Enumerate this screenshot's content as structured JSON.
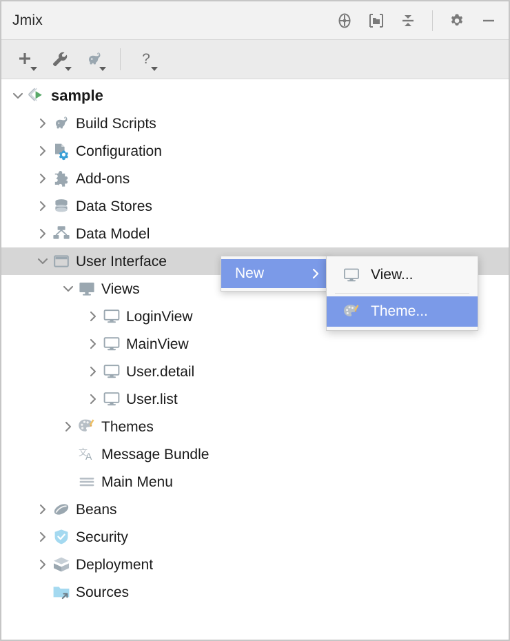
{
  "window": {
    "title": "Jmix"
  },
  "titlebar": {
    "actions": [
      {
        "name": "locate-icon",
        "label": "Locate"
      },
      {
        "name": "expand-folder-icon",
        "label": "Open Directory"
      },
      {
        "name": "collapse-all-icon",
        "label": "Collapse All"
      },
      {
        "name": "settings-gear-icon",
        "label": "Settings"
      },
      {
        "name": "minimize-icon",
        "label": "Hide"
      }
    ]
  },
  "toolbar": {
    "buttons": [
      {
        "name": "add-icon",
        "label": "New"
      },
      {
        "name": "wrench-icon",
        "label": "Tools"
      },
      {
        "name": "gradle-elephant-icon",
        "label": "Gradle"
      },
      {
        "name": "help-question-icon",
        "label": "Help"
      }
    ]
  },
  "tree": {
    "nodes": [
      {
        "label": "sample",
        "icon": "jmix-project-icon",
        "depth": 0,
        "arrow": "down",
        "root": true,
        "selected": false
      },
      {
        "label": "Build Scripts",
        "icon": "gradle-elephant-icon",
        "depth": 1,
        "arrow": "right",
        "root": false,
        "selected": false
      },
      {
        "label": "Configuration",
        "icon": "configuration-icon",
        "depth": 1,
        "arrow": "right",
        "root": false,
        "selected": false
      },
      {
        "label": "Add-ons",
        "icon": "puzzle-piece-icon",
        "depth": 1,
        "arrow": "right",
        "root": false,
        "selected": false
      },
      {
        "label": "Data Stores",
        "icon": "database-icon",
        "depth": 1,
        "arrow": "right",
        "root": false,
        "selected": false
      },
      {
        "label": "Data Model",
        "icon": "data-model-icon",
        "depth": 1,
        "arrow": "right",
        "root": false,
        "selected": false
      },
      {
        "label": "User Interface",
        "icon": "user-interface-icon",
        "depth": 1,
        "arrow": "down",
        "root": false,
        "selected": true
      },
      {
        "label": "Views",
        "icon": "views-folder-icon",
        "depth": 2,
        "arrow": "down",
        "root": false,
        "selected": false
      },
      {
        "label": "LoginView",
        "icon": "view-monitor-icon",
        "depth": 3,
        "arrow": "right",
        "root": false,
        "selected": false
      },
      {
        "label": "MainView",
        "icon": "view-monitor-icon",
        "depth": 3,
        "arrow": "right",
        "root": false,
        "selected": false
      },
      {
        "label": "User.detail",
        "icon": "view-monitor-icon",
        "depth": 3,
        "arrow": "right",
        "root": false,
        "selected": false
      },
      {
        "label": "User.list",
        "icon": "view-monitor-icon",
        "depth": 3,
        "arrow": "right",
        "root": false,
        "selected": false
      },
      {
        "label": "Themes",
        "icon": "palette-icon",
        "depth": 2,
        "arrow": "right",
        "root": false,
        "selected": false
      },
      {
        "label": "Message Bundle",
        "icon": "translation-icon",
        "depth": 2,
        "arrow": "none",
        "root": false,
        "selected": false
      },
      {
        "label": "Main Menu",
        "icon": "hamburger-icon",
        "depth": 2,
        "arrow": "none",
        "root": false,
        "selected": false
      },
      {
        "label": "Beans",
        "icon": "coffee-bean-icon",
        "depth": 1,
        "arrow": "right",
        "root": false,
        "selected": false
      },
      {
        "label": "Security",
        "icon": "shield-check-icon",
        "depth": 1,
        "arrow": "right",
        "root": false,
        "selected": false
      },
      {
        "label": "Deployment",
        "icon": "open-box-icon",
        "depth": 1,
        "arrow": "right",
        "root": false,
        "selected": false
      },
      {
        "label": "Sources",
        "icon": "blue-folder-icon",
        "depth": 1,
        "arrow": "none",
        "root": false,
        "selected": false
      }
    ]
  },
  "context_menu": {
    "items": [
      {
        "label": "New",
        "has_submenu": true,
        "highlighted": true
      }
    ]
  },
  "sub_menu": {
    "items": [
      {
        "label": "View...",
        "icon": "view-monitor-icon",
        "highlighted": false
      },
      {
        "label": "Theme...",
        "icon": "palette-icon",
        "highlighted": true
      }
    ]
  },
  "colors": {
    "menu_highlight": "#7b9ae8",
    "tree_selection": "#d6d6d6",
    "accent_blue": "#389fd6",
    "run_green": "#59a869",
    "icon_gray": "#9aa7b0",
    "titlebar_bg": "#f2f2f2",
    "toolbar_bg": "#ebebeb"
  }
}
